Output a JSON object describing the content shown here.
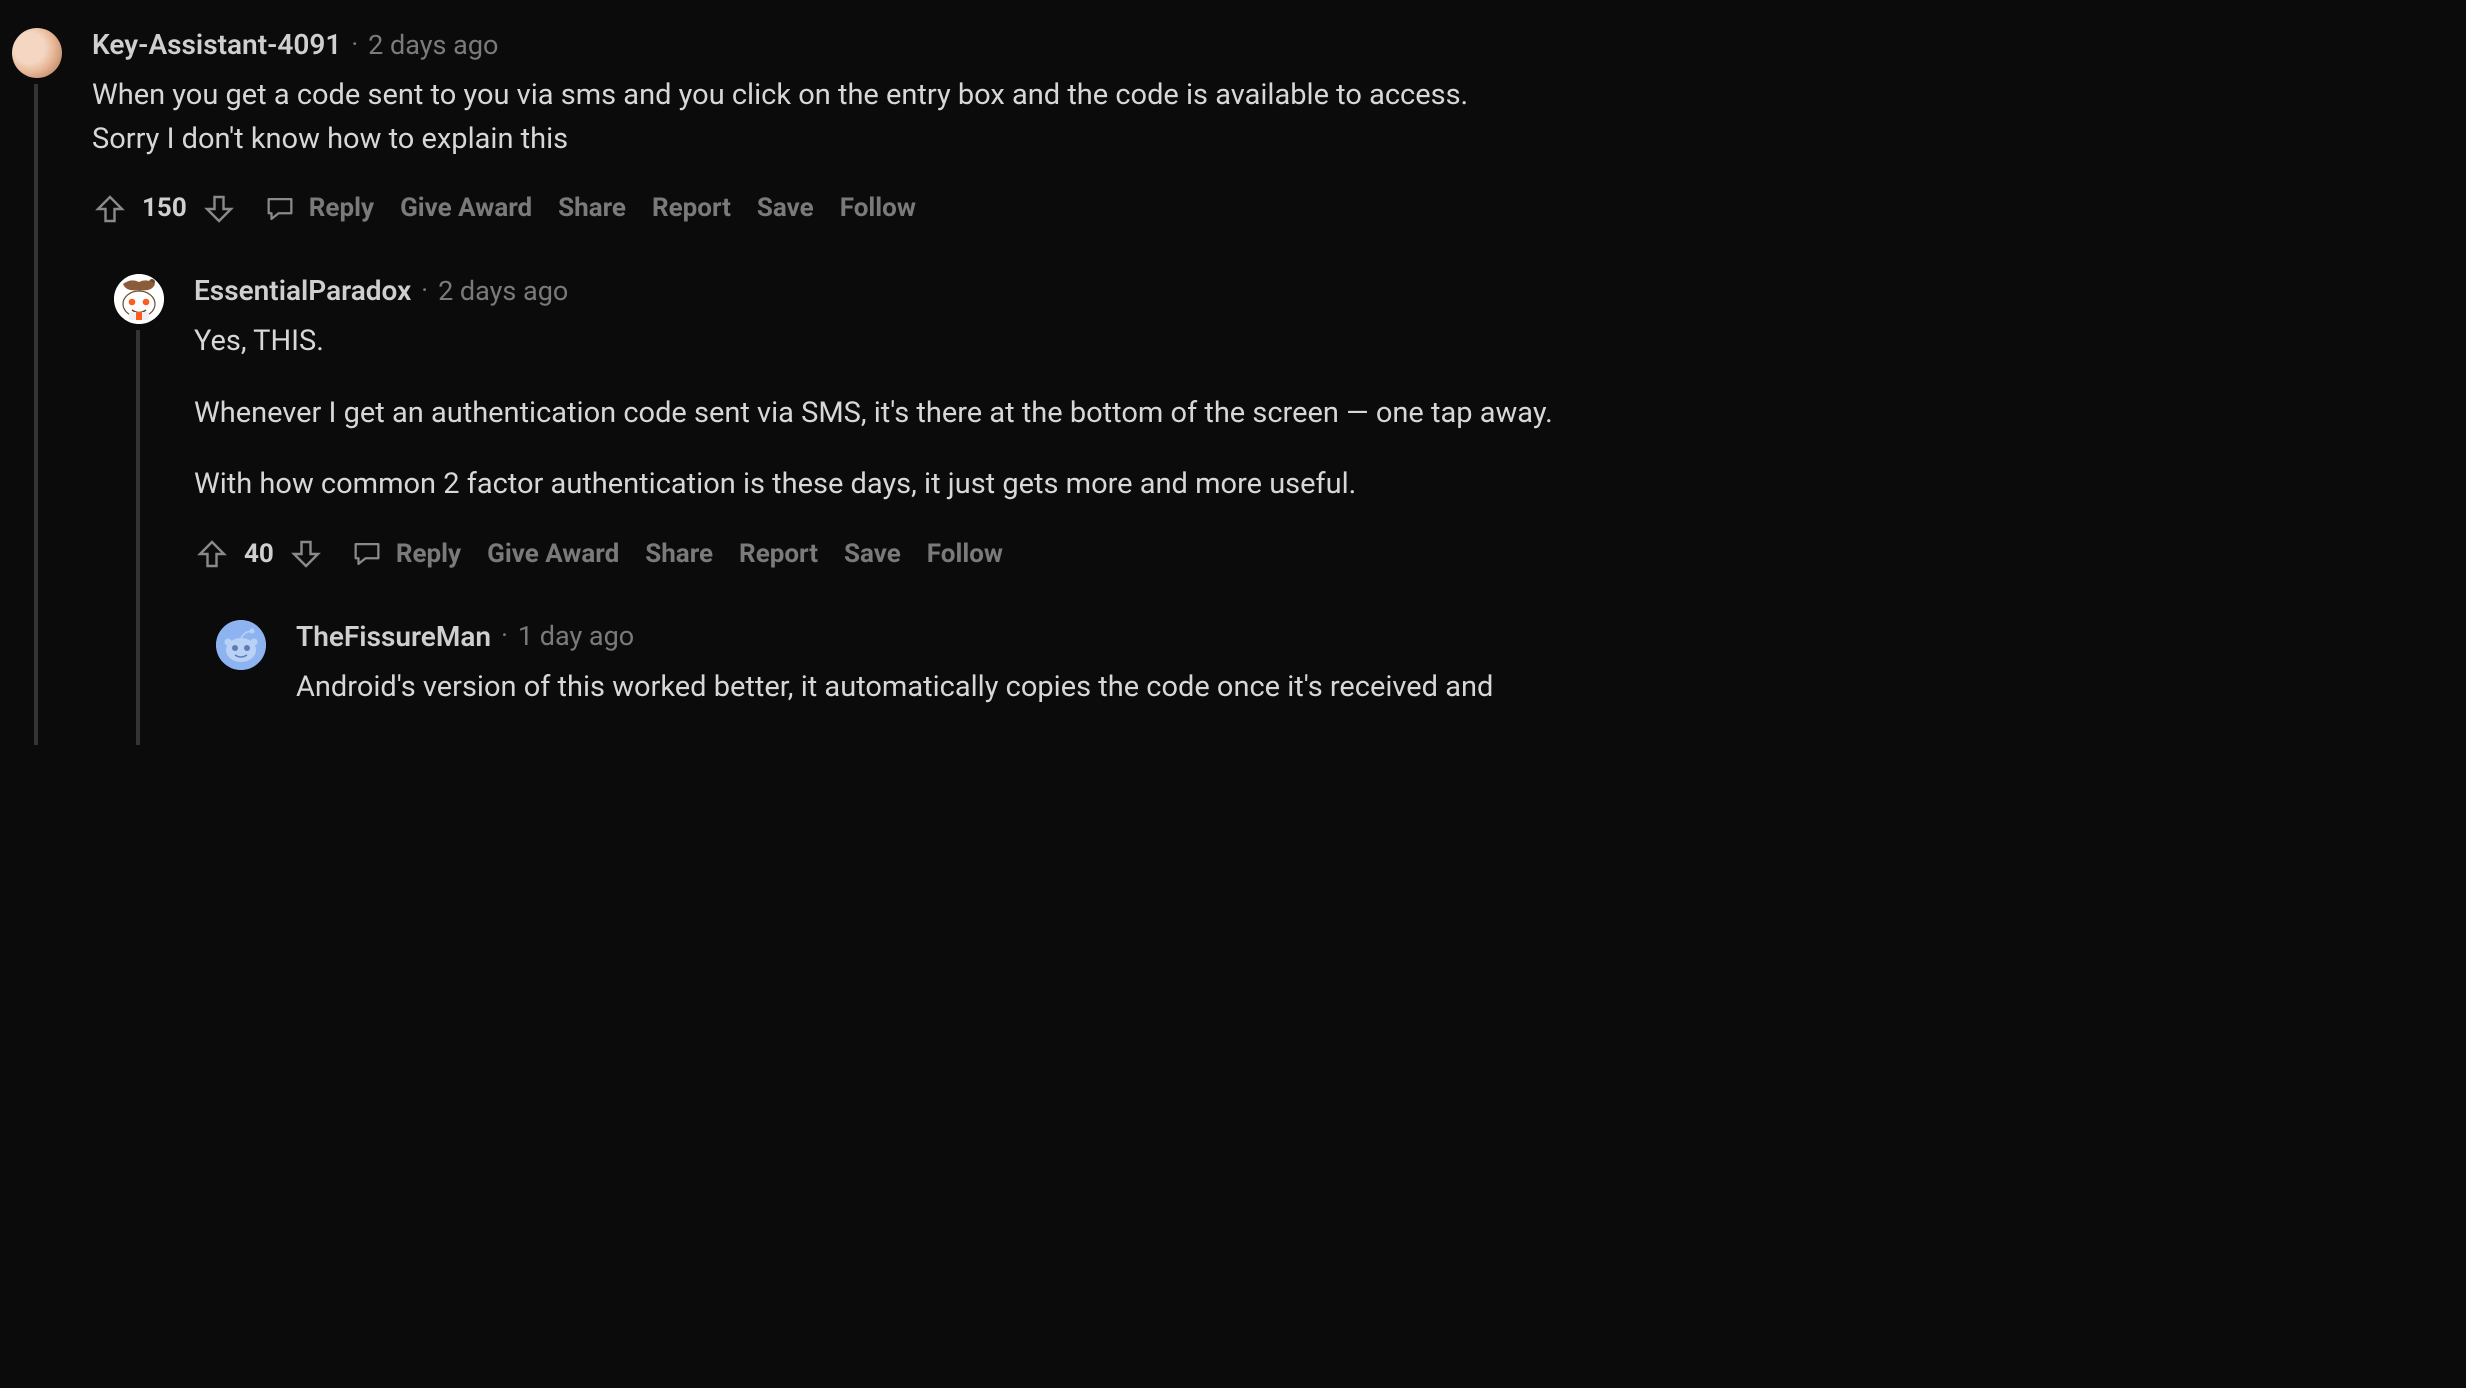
{
  "comments": [
    {
      "username": "Key-Assistant-4091",
      "timestamp": "2 days ago",
      "body": [
        "When you get a code sent to you via sms and you click on the entry box and the code is available to access. Sorry I don't know how to explain this"
      ],
      "score": "150",
      "avatar_type": "photo1"
    },
    {
      "username": "EssentialParadox",
      "timestamp": "2 days ago",
      "body": [
        "Yes, THIS.",
        "Whenever I get an authentication code sent via SMS, it's there at the bottom of the screen — one tap away.",
        "With how common 2 factor authentication is these days, it just gets more and more useful."
      ],
      "score": "40",
      "avatar_type": "snoo2"
    },
    {
      "username": "TheFissureMan",
      "timestamp": "1 day ago",
      "body": [
        "Android's version of this worked better, it automatically copies the code once it's received and"
      ],
      "score": "",
      "avatar_type": "snoo3"
    }
  ],
  "labels": {
    "reply": "Reply",
    "award": "Give Award",
    "share": "Share",
    "report": "Report",
    "save": "Save",
    "follow": "Follow",
    "dot": "·"
  }
}
